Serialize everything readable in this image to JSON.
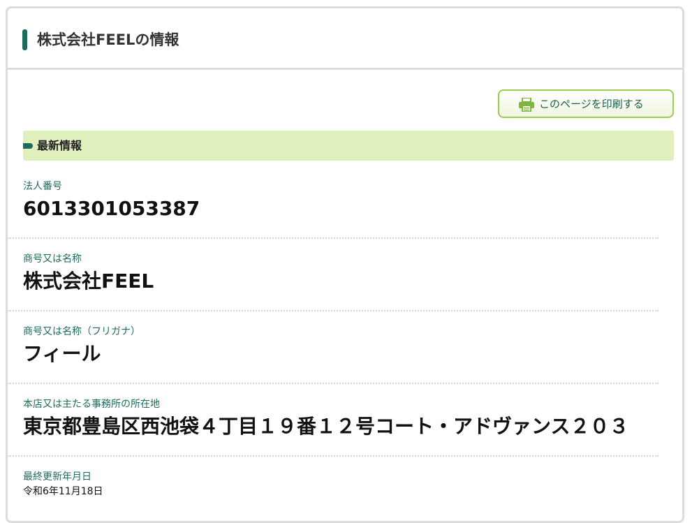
{
  "header": {
    "title": "株式会社FEELの情報"
  },
  "toolbar": {
    "print_label": "このページを印刷する",
    "print_icon": "printer-icon"
  },
  "section": {
    "title": "最新情報"
  },
  "fields": {
    "corporate_number": {
      "label": "法人番号",
      "value": "6013301053387"
    },
    "trade_name": {
      "label": "商号又は名称",
      "value": "株式会社FEEL"
    },
    "trade_name_kana": {
      "label": "商号又は名称（フリガナ）",
      "value": "フィール"
    },
    "address": {
      "label": "本店又は主たる事務所の所在地",
      "value": "東京都豊島区西池袋４丁目１９番１２号コート・アドヴァンス２０３"
    },
    "last_updated": {
      "label": "最終更新年月日",
      "value": "令和6年11月18日"
    }
  },
  "colors": {
    "accent": "#1e6b5e",
    "section_bg": "#dff0bc",
    "button_border": "#9ccc50"
  }
}
